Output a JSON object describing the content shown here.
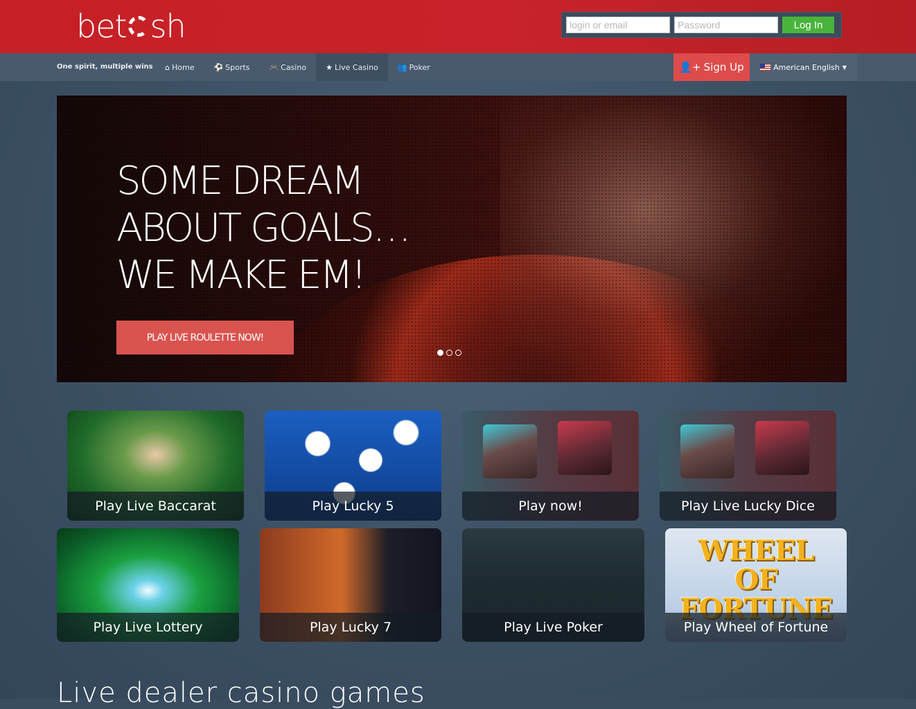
{
  "brand": {
    "logo_text_left": "bet",
    "logo_text_right": "sh"
  },
  "login": {
    "login_placeholder": "login or email",
    "password_placeholder": "Password",
    "login_button": "Log In"
  },
  "nav": {
    "tagline": "One spirit, multiple wins",
    "items": [
      {
        "label": "Home",
        "icon": "home-icon",
        "glyph": "⌂"
      },
      {
        "label": "Sports",
        "icon": "soccer-ball-icon",
        "glyph": "⚽"
      },
      {
        "label": "Casino",
        "icon": "gamepad-icon",
        "glyph": "🎮"
      },
      {
        "label": "Live Casino",
        "icon": "star-icon",
        "glyph": "★"
      },
      {
        "label": "Poker",
        "icon": "users-icon",
        "glyph": "👥"
      }
    ],
    "signup_label": "Sign Up",
    "language_label": "American English"
  },
  "hero": {
    "headline_line1": "SOME DREAM",
    "headline_line2": "ABOUT GOALS…",
    "headline_line3": "WE MAKE EM!",
    "cta_label": "PLAY LIVE ROULETTE NOW!",
    "slide_count": 3,
    "active_slide": 1
  },
  "games": [
    {
      "label": "Play Live Baccarat"
    },
    {
      "label": "Play Lucky 5"
    },
    {
      "label": "Play now!"
    },
    {
      "label": "Play Live Lucky Dice"
    },
    {
      "label": "Play Live Lottery"
    },
    {
      "label": "Play Lucky 7"
    },
    {
      "label": "Play Live Poker"
    },
    {
      "label": "Play Wheel of Fortune"
    }
  ],
  "wheel_art": {
    "line1": "WHEEL OF",
    "line2": "FORTUNE"
  },
  "section": {
    "title": "Live dealer casino games"
  },
  "colors": {
    "header_red": "#c62026",
    "navbar": "#485a6c",
    "signup_red": "#dd4b4b",
    "login_green": "#49b43b",
    "page_bg": "#3a4c5f"
  }
}
